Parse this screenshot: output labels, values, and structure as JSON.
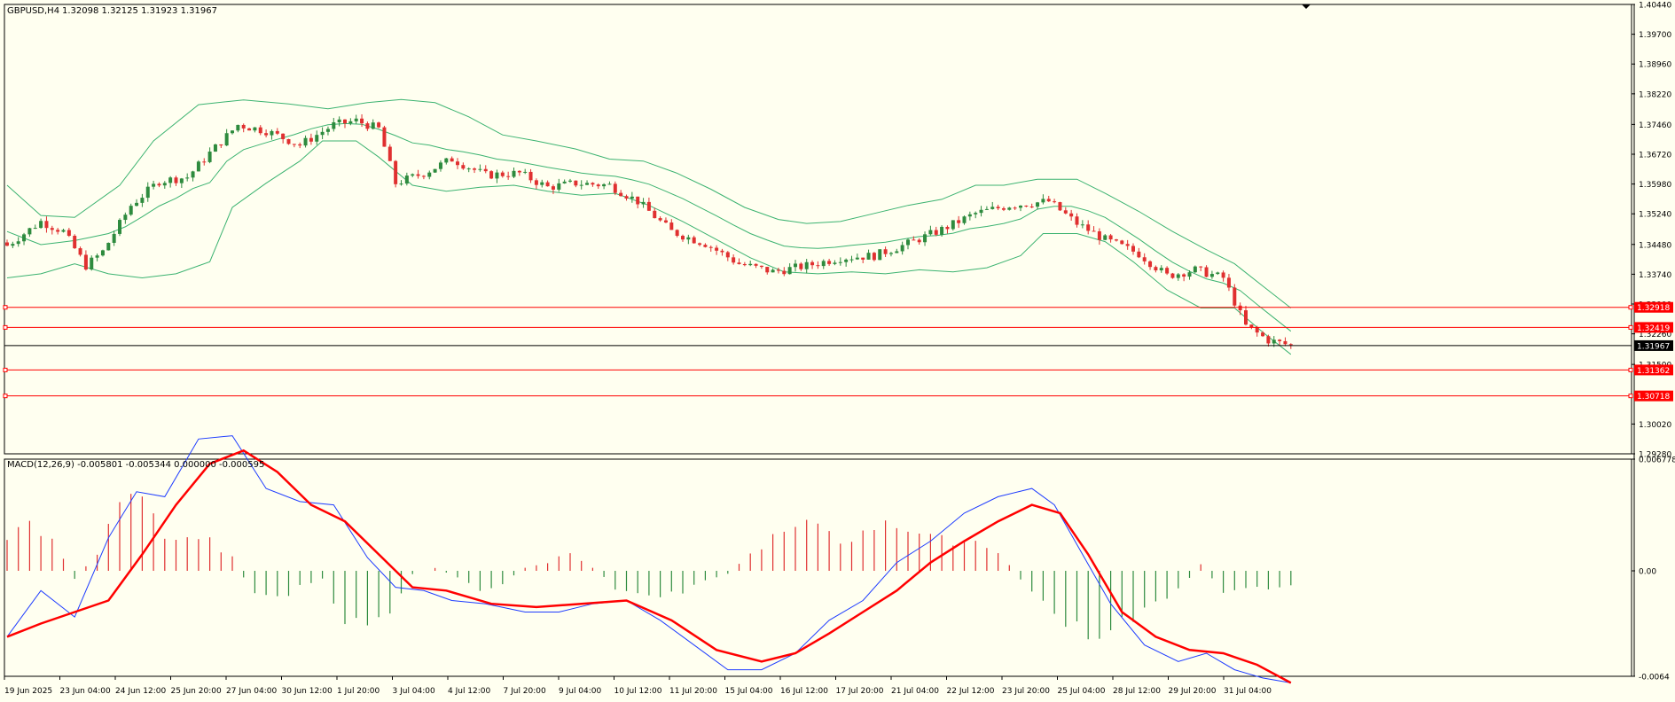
{
  "header": {
    "symbol_tf": "GBPUSD,H4",
    "ohlc": "1.32098 1.32125 1.31923 1.31967"
  },
  "macd_header": "MACD(12,26,9) -0.005801 -0.005344 0.000000 -0.000595",
  "colors": {
    "background": "#fffff0",
    "bull": "#2e8b3e",
    "bear": "#e03030",
    "bollinger": "#3cb371",
    "level": "#ff0000",
    "price_line": "#000000",
    "macd_main": "#1e3cff",
    "macd_signal": "#ff0000"
  },
  "chart_data": [
    {
      "type": "candlestick",
      "panel": "price",
      "symbol": "GBPUSD",
      "timeframe": "H4",
      "ylim": [
        1.2928,
        1.4044
      ],
      "y_ticks": [
        "1.40440",
        "1.39700",
        "1.38960",
        "1.38220",
        "1.37460",
        "1.36720",
        "1.35980",
        "1.35240",
        "1.34480",
        "1.33740",
        "1.33000",
        "1.32260",
        "1.31500",
        "1.30020",
        "1.29280"
      ],
      "x_ticks": [
        "19 Jun 2025",
        "23 Jun 04:00",
        "24 Jun 12:00",
        "25 Jun 20:00",
        "27 Jun 04:00",
        "30 Jun 12:00",
        "1 Jul 20:00",
        "3 Jul 04:00",
        "4 Jul 12:00",
        "7 Jul 20:00",
        "9 Jul 04:00",
        "10 Jul 12:00",
        "11 Jul 20:00",
        "15 Jul 04:00",
        "16 Jul 12:00",
        "17 Jul 20:00",
        "21 Jul 04:00",
        "22 Jul 12:00",
        "23 Jul 20:00",
        "25 Jul 04:00",
        "28 Jul 12:00",
        "29 Jul 20:00",
        "31 Jul 04:00"
      ],
      "close_path": [
        [
          0,
          1.3445
        ],
        [
          6,
          1.3505
        ],
        [
          10,
          1.348
        ],
        [
          14,
          1.3395
        ],
        [
          17,
          1.343
        ],
        [
          22,
          1.3545
        ],
        [
          27,
          1.3605
        ],
        [
          32,
          1.3615
        ],
        [
          36,
          1.3675
        ],
        [
          41,
          1.3745
        ],
        [
          46,
          1.373
        ],
        [
          52,
          1.3695
        ],
        [
          58,
          1.3745
        ],
        [
          62,
          1.3755
        ],
        [
          66,
          1.3735
        ],
        [
          69,
          1.36
        ],
        [
          74,
          1.3625
        ],
        [
          79,
          1.366
        ],
        [
          85,
          1.362
        ],
        [
          91,
          1.3625
        ],
        [
          96,
          1.359
        ],
        [
          101,
          1.36
        ],
        [
          107,
          1.3595
        ],
        [
          112,
          1.3555
        ],
        [
          118,
          1.348
        ],
        [
          124,
          1.345
        ],
        [
          130,
          1.34
        ],
        [
          136,
          1.338
        ],
        [
          142,
          1.3395
        ],
        [
          148,
          1.3415
        ],
        [
          154,
          1.342
        ],
        [
          160,
          1.345
        ],
        [
          166,
          1.3485
        ],
        [
          172,
          1.3525
        ],
        [
          178,
          1.3545
        ],
        [
          185,
          1.3555
        ],
        [
          190,
          1.35
        ],
        [
          195,
          1.346
        ],
        [
          201,
          1.3425
        ],
        [
          206,
          1.337
        ],
        [
          211,
          1.3385
        ],
        [
          216,
          1.3365
        ],
        [
          220,
          1.3245
        ],
        [
          224,
          1.321
        ],
        [
          228,
          1.3197
        ]
      ],
      "bollinger_upper": [
        [
          0,
          1.3595
        ],
        [
          6,
          1.352
        ],
        [
          12,
          1.3515
        ],
        [
          20,
          1.3595
        ],
        [
          26,
          1.3705
        ],
        [
          34,
          1.3795
        ],
        [
          42,
          1.3807
        ],
        [
          50,
          1.3797
        ],
        [
          57,
          1.3785
        ],
        [
          64,
          1.38
        ],
        [
          70,
          1.3808
        ],
        [
          76,
          1.38
        ],
        [
          82,
          1.3765
        ],
        [
          88,
          1.372
        ],
        [
          94,
          1.3705
        ],
        [
          101,
          1.3685
        ],
        [
          107,
          1.366
        ],
        [
          113,
          1.3655
        ],
        [
          119,
          1.3625
        ],
        [
          125,
          1.3585
        ],
        [
          131,
          1.354
        ],
        [
          137,
          1.351
        ],
        [
          142,
          1.35
        ],
        [
          148,
          1.3505
        ],
        [
          154,
          1.3525
        ],
        [
          160,
          1.3545
        ],
        [
          166,
          1.356
        ],
        [
          172,
          1.3595
        ],
        [
          177,
          1.3595
        ],
        [
          183,
          1.361
        ],
        [
          190,
          1.361
        ],
        [
          195,
          1.3575
        ],
        [
          201,
          1.353
        ],
        [
          207,
          1.348
        ],
        [
          213,
          1.3435
        ],
        [
          218,
          1.34
        ],
        [
          223,
          1.3345
        ],
        [
          228,
          1.329
        ]
      ],
      "bollinger_lower": [
        [
          0,
          1.3365
        ],
        [
          6,
          1.3375
        ],
        [
          12,
          1.34
        ],
        [
          18,
          1.3375
        ],
        [
          24,
          1.3365
        ],
        [
          30,
          1.3375
        ],
        [
          36,
          1.3405
        ],
        [
          40,
          1.354
        ],
        [
          46,
          1.36
        ],
        [
          52,
          1.3655
        ],
        [
          56,
          1.3705
        ],
        [
          62,
          1.3705
        ],
        [
          66,
          1.3665
        ],
        [
          72,
          1.3595
        ],
        [
          78,
          1.358
        ],
        [
          84,
          1.359
        ],
        [
          90,
          1.3595
        ],
        [
          96,
          1.358
        ],
        [
          102,
          1.357
        ],
        [
          108,
          1.3575
        ],
        [
          114,
          1.3545
        ],
        [
          120,
          1.3505
        ],
        [
          126,
          1.346
        ],
        [
          132,
          1.3415
        ],
        [
          138,
          1.338
        ],
        [
          144,
          1.3375
        ],
        [
          150,
          1.338
        ],
        [
          156,
          1.3375
        ],
        [
          162,
          1.3385
        ],
        [
          168,
          1.338
        ],
        [
          174,
          1.339
        ],
        [
          180,
          1.342
        ],
        [
          184,
          1.3475
        ],
        [
          190,
          1.3475
        ],
        [
          195,
          1.3455
        ],
        [
          200,
          1.3405
        ],
        [
          206,
          1.3335
        ],
        [
          212,
          1.329
        ],
        [
          218,
          1.329
        ],
        [
          223,
          1.323
        ],
        [
          228,
          1.3175
        ]
      ],
      "horizontal_levels": [
        "1.32918",
        "1.32419",
        "1.31362",
        "1.30718"
      ],
      "current_price": "1.31967"
    },
    {
      "type": "macd",
      "panel": "indicator",
      "params": "12,26,9",
      "ylim": [
        -0.0064,
        0.006778
      ],
      "y_ticks": [
        "0.006778",
        "0.00",
        "-0.0064"
      ],
      "main_path": [
        [
          0,
          -0.004
        ],
        [
          6,
          -0.0012
        ],
        [
          12,
          -0.0028
        ],
        [
          18,
          0.002
        ],
        [
          23,
          0.0048
        ],
        [
          28,
          0.0045
        ],
        [
          34,
          0.008
        ],
        [
          40,
          0.0082
        ],
        [
          46,
          0.005
        ],
        [
          52,
          0.0042
        ],
        [
          58,
          0.004
        ],
        [
          64,
          0.0008
        ],
        [
          69,
          -0.001
        ],
        [
          74,
          -0.0012
        ],
        [
          79,
          -0.0018
        ],
        [
          85,
          -0.002
        ],
        [
          92,
          -0.0025
        ],
        [
          98,
          -0.0025
        ],
        [
          104,
          -0.002
        ],
        [
          110,
          -0.0018
        ],
        [
          116,
          -0.003
        ],
        [
          122,
          -0.0045
        ],
        [
          128,
          -0.006
        ],
        [
          134,
          -0.006
        ],
        [
          140,
          -0.005
        ],
        [
          146,
          -0.003
        ],
        [
          152,
          -0.0018
        ],
        [
          158,
          0.0005
        ],
        [
          164,
          0.0018
        ],
        [
          170,
          0.0035
        ],
        [
          176,
          0.0045
        ],
        [
          182,
          0.005
        ],
        [
          186,
          0.004
        ],
        [
          191,
          0.001
        ],
        [
          196,
          -0.002
        ],
        [
          202,
          -0.0045
        ],
        [
          208,
          -0.0055
        ],
        [
          213,
          -0.005
        ],
        [
          218,
          -0.006
        ],
        [
          223,
          -0.0065
        ],
        [
          228,
          -0.0068
        ]
      ],
      "signal_path": [
        [
          0,
          -0.004
        ],
        [
          6,
          -0.0032
        ],
        [
          12,
          -0.0025
        ],
        [
          18,
          -0.0018
        ],
        [
          24,
          0.001
        ],
        [
          30,
          0.004
        ],
        [
          36,
          0.0065
        ],
        [
          42,
          0.0073
        ],
        [
          48,
          0.006
        ],
        [
          54,
          0.004
        ],
        [
          60,
          0.003
        ],
        [
          66,
          0.001
        ],
        [
          72,
          -0.001
        ],
        [
          78,
          -0.0012
        ],
        [
          86,
          -0.002
        ],
        [
          94,
          -0.0022
        ],
        [
          102,
          -0.002
        ],
        [
          110,
          -0.0018
        ],
        [
          118,
          -0.003
        ],
        [
          126,
          -0.0048
        ],
        [
          134,
          -0.0055
        ],
        [
          140,
          -0.005
        ],
        [
          146,
          -0.0038
        ],
        [
          152,
          -0.0025
        ],
        [
          158,
          -0.0012
        ],
        [
          164,
          0.0005
        ],
        [
          170,
          0.0018
        ],
        [
          176,
          0.003
        ],
        [
          182,
          0.004
        ],
        [
          187,
          0.0035
        ],
        [
          192,
          0.001
        ],
        [
          198,
          -0.0025
        ],
        [
          204,
          -0.004
        ],
        [
          210,
          -0.0048
        ],
        [
          216,
          -0.005
        ],
        [
          222,
          -0.0057
        ],
        [
          228,
          -0.0068
        ]
      ],
      "histogram_path": [
        [
          0,
          0.002
        ],
        [
          4,
          0.003
        ],
        [
          8,
          0.0018
        ],
        [
          12,
          -0.0005
        ],
        [
          16,
          0.001
        ],
        [
          20,
          0.0045
        ],
        [
          24,
          0.005
        ],
        [
          28,
          0.002
        ],
        [
          32,
          0.0018
        ],
        [
          36,
          0.0018
        ],
        [
          40,
          0.0008
        ],
        [
          44,
          -0.0015
        ],
        [
          48,
          -0.0018
        ],
        [
          52,
          -0.001
        ],
        [
          56,
          -0.0005
        ],
        [
          60,
          -0.003
        ],
        [
          64,
          -0.0035
        ],
        [
          68,
          -0.0025
        ],
        [
          72,
          -0.0002
        ],
        [
          76,
          0.0002
        ],
        [
          80,
          -0.0004
        ],
        [
          84,
          -0.0012
        ],
        [
          88,
          -0.0008
        ],
        [
          92,
          0.0002
        ],
        [
          96,
          0.0005
        ],
        [
          100,
          0.0012
        ],
        [
          104,
          0.0002
        ],
        [
          108,
          -0.001
        ],
        [
          112,
          -0.0015
        ],
        [
          116,
          -0.0015
        ],
        [
          120,
          -0.0012
        ],
        [
          124,
          -0.0005
        ],
        [
          128,
          -0.0002
        ],
        [
          132,
          0.001
        ],
        [
          136,
          0.002
        ],
        [
          140,
          0.0025
        ],
        [
          144,
          0.003
        ],
        [
          148,
          0.0018
        ],
        [
          152,
          0.0022
        ],
        [
          156,
          0.0032
        ],
        [
          160,
          0.0025
        ],
        [
          164,
          0.002
        ],
        [
          168,
          0.0018
        ],
        [
          172,
          0.0018
        ],
        [
          176,
          0.0012
        ],
        [
          180,
          -0.0005
        ],
        [
          184,
          -0.002
        ],
        [
          188,
          -0.003
        ],
        [
          192,
          -0.004
        ],
        [
          196,
          -0.0035
        ],
        [
          200,
          -0.003
        ],
        [
          204,
          -0.002
        ],
        [
          208,
          -0.0012
        ],
        [
          212,
          0.0004
        ],
        [
          216,
          -0.0012
        ],
        [
          220,
          -0.0012
        ],
        [
          224,
          -0.001
        ],
        [
          228,
          -0.0008
        ]
      ]
    }
  ]
}
